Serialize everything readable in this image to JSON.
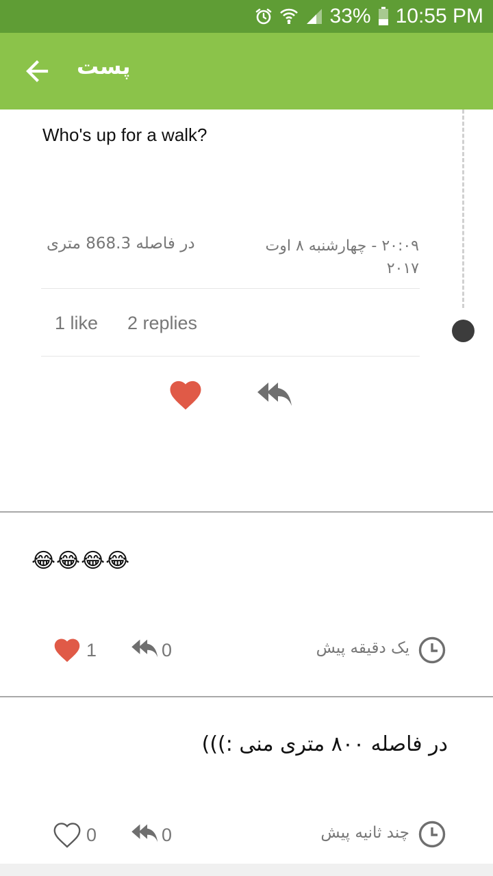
{
  "status_bar": {
    "battery": "33%",
    "time": "10:55 PM"
  },
  "app_bar": {
    "title": "پست"
  },
  "post": {
    "body": "Who's up for a walk?",
    "distance": "در فاصله 868.3 متری",
    "date": "۲۰:۰۹ - چهارشنبه ۸ اوت ۲۰۱۷",
    "likes": "1 like",
    "replies": "2 replies",
    "liked": true
  },
  "replies": [
    {
      "text": "😂😂😂😂",
      "time": "یک دقیقه پیش",
      "like_count": "1",
      "reply_count": "0",
      "liked": true
    },
    {
      "text": "در فاصله ۸۰۰ متری منی :)))",
      "time": "چند ثانیه پیش",
      "like_count": "0",
      "reply_count": "0",
      "liked": false
    }
  ],
  "colors": {
    "status_bar": "#5f9d35",
    "app_bar": "#8bc34a",
    "heart": "#e05a47",
    "icon_gray": "#6f6f6f"
  },
  "icons": {
    "back": "arrow-left-icon",
    "alarm": "alarm-icon",
    "wifi": "wifi-icon",
    "signal": "signal-icon",
    "battery": "battery-icon",
    "like": "heart-icon",
    "reply": "reply-all-icon",
    "time": "clock-icon"
  }
}
